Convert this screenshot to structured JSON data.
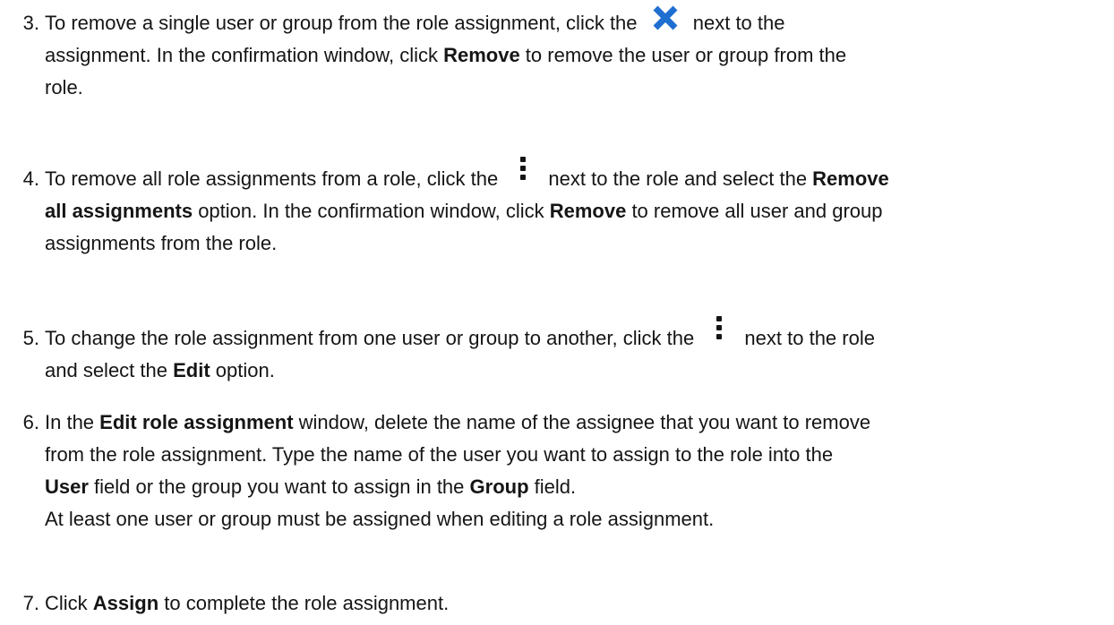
{
  "steps": [
    {
      "number": "3.",
      "lines": [
        [
          "To remove a single user or group from the role assignment, click the ",
          {
            "icon": "close-icon"
          },
          " next to the"
        ],
        [
          "assignment. In the confirmation window, click ",
          {
            "b": "Remove"
          },
          " to remove the user or group from the"
        ],
        [
          "role."
        ]
      ]
    },
    {
      "number": "4.",
      "lines": [
        [
          "To remove all role assignments from a role, click the ",
          {
            "icon": "kebab-menu-icon"
          },
          " next to the role and select the ",
          {
            "b": "Remove"
          }
        ],
        [
          {
            "b": "all assignments"
          },
          " option. In the confirmation window, click  ",
          {
            "b": "Remove"
          },
          " to remove all user and group"
        ],
        [
          "assignments from the role."
        ]
      ]
    },
    {
      "number": "5.",
      "lines": [
        [
          "To change the role assignment from one user or group to another, click the ",
          {
            "icon": "kebab-menu-icon"
          },
          " next to the role"
        ],
        [
          "and select the ",
          {
            "b": "Edit"
          },
          " option."
        ]
      ]
    },
    {
      "number": "6.",
      "lines": [
        [
          "In the ",
          {
            "b": "Edit role assignment"
          },
          " window, delete the name of the assignee that you want to remove"
        ],
        [
          "from the role assignment. Type the name of the user you want to assign to the role into the"
        ],
        [
          {
            "b": "User"
          },
          " field or the group you want to assign in the  ",
          {
            "b": "Group"
          },
          " field."
        ],
        [
          "At least one user or group must be assigned when editing a role assignment."
        ]
      ]
    },
    {
      "number": "7.",
      "lines": [
        [
          "Click ",
          {
            "b": "Assign"
          },
          " to complete the role assignment."
        ]
      ]
    }
  ],
  "colors": {
    "text": "#151515",
    "close_icon": "#1f6fd1",
    "kebab_icon": "#151515"
  }
}
